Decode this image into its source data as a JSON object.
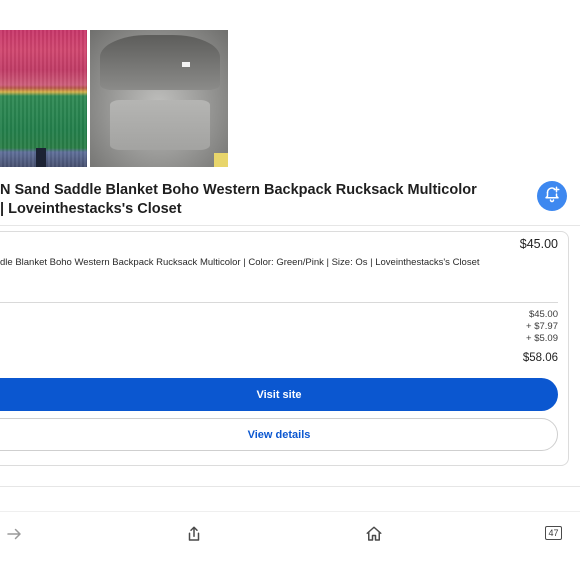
{
  "product": {
    "title_line1": "N Sand Saddle Blanket Boho Western Backpack Rucksack Multicolor",
    "title_line2": "| Loveinthestacks's Closet"
  },
  "offer": {
    "price": "$45.00",
    "description": "dle Blanket Boho Western Backpack Rucksack Multicolor | Color: Green/Pink | Size: Os | Loveinthestacks's Closet",
    "breakdown": [
      "$45.00",
      "+ $7.97",
      "+ $5.09"
    ],
    "total": "$58.06",
    "visit_label": "Visit site",
    "details_label": "View details"
  },
  "toolbar": {
    "tab_count": "47"
  },
  "colors": {
    "accent": "#0b57d0",
    "fab": "#3d88f0"
  },
  "icons": [
    "add-alert-icon",
    "forward-arrow-icon",
    "share-icon",
    "home-icon",
    "tabs-icon"
  ]
}
